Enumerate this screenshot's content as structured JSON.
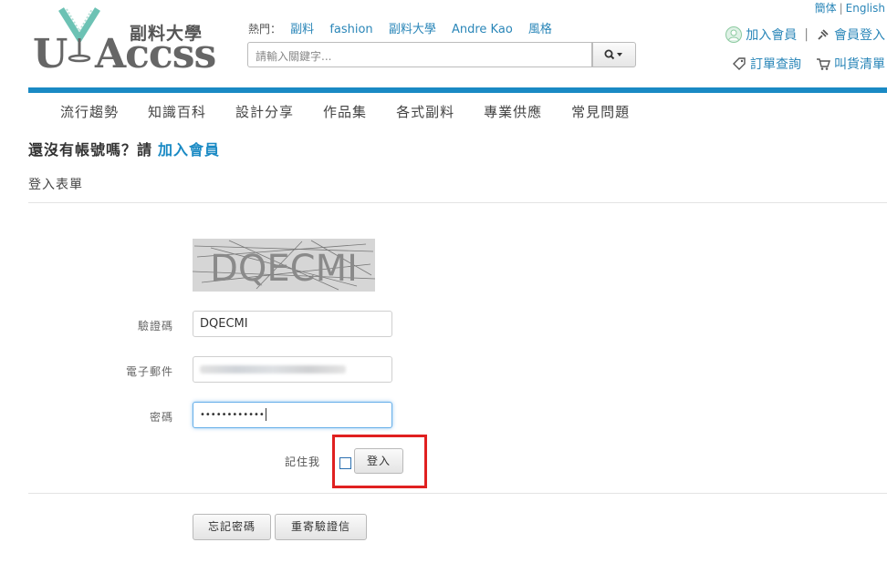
{
  "header": {
    "lang": {
      "simplified": "簡体",
      "english": "English"
    },
    "logo": {
      "tagline": "副料大學",
      "u": "U",
      "accss": "Accss"
    },
    "hot": {
      "label": "熱門：",
      "links": [
        "副料",
        "fashion",
        "副料大學",
        "Andre Kao",
        "風格"
      ]
    },
    "search": {
      "placeholder": "請輸入關鍵字..."
    },
    "account": {
      "join": "加入會員",
      "login": "會員登入",
      "orders": "訂單查詢",
      "cart": "叫貨清單"
    }
  },
  "nav": [
    "流行趨勢",
    "知識百科",
    "設計分享",
    "作品集",
    "各式副料",
    "專業供應",
    "常見問題"
  ],
  "page": {
    "signup_prompt": "還沒有帳號嗎？請",
    "signup_link": "加入會員",
    "form_title": "登入表單"
  },
  "form": {
    "captcha_text": "DQECMI",
    "captcha_label": "驗證碼",
    "captcha_value": "DQECMI",
    "email_label": "電子郵件",
    "password_label": "密碼",
    "password_value": "••••••••••••",
    "remember_label": "記住我",
    "login_button": "登入",
    "forgot_button": "忘記密碼",
    "resend_button": "重寄驗證信"
  },
  "colors": {
    "accent": "#1a8ac4",
    "highlight": "#e02020"
  }
}
